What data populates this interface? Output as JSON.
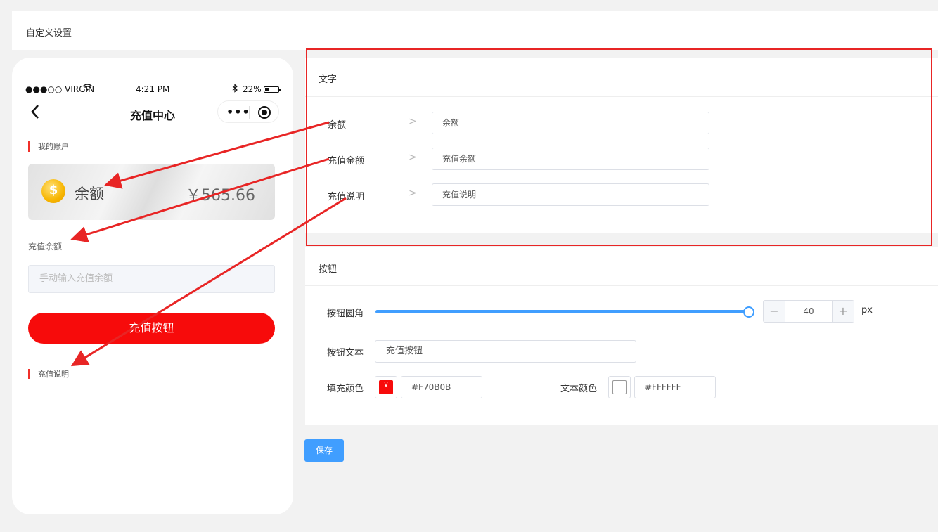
{
  "page_title": "自定义设置",
  "phone": {
    "status": {
      "carrier": "●●●○○ VIRGIN",
      "time": "4:21 PM",
      "battery": "22%"
    },
    "nav_title": "充值中心",
    "account_label": "我的账户",
    "balance_label": "余额",
    "balance_value": "￥565.66",
    "amount_label": "充值余额",
    "amount_placeholder": "手动输入充值余额",
    "button_text": "充值按钮",
    "desc_label": "充值说明"
  },
  "text_section": {
    "title": "文字",
    "fields": [
      {
        "label": "余额",
        "value": "余额"
      },
      {
        "label": "充值金额",
        "value": "充值余额"
      },
      {
        "label": "充值说明",
        "value": "充值说明"
      }
    ]
  },
  "button_section": {
    "title": "按钮",
    "radius_label": "按钮圆角",
    "radius_value": "40",
    "radius_unit": "px",
    "text_label": "按钮文本",
    "text_value": "充值按钮",
    "fill_label": "填充颜色",
    "fill_color": "#F70B0B",
    "text_color_label": "文本颜色",
    "text_color": "#FFFFFF"
  },
  "save_label": "保存",
  "colors": {
    "accent": "#409eff",
    "button_red": "#f70b0b",
    "highlight": "#e82525"
  }
}
